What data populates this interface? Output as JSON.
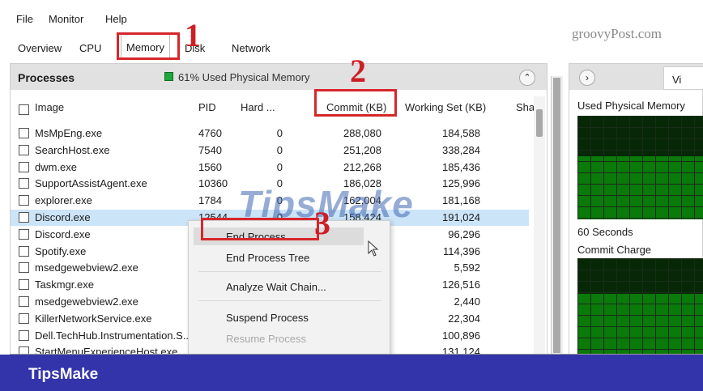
{
  "menu": {
    "file": "File",
    "monitor": "Monitor",
    "help": "Help"
  },
  "tabs": {
    "overview": "Overview",
    "cpu": "CPU",
    "memory": "Memory",
    "disk": "Disk",
    "network": "Network"
  },
  "watermark_top": "groovyPost.com",
  "watermark_mid": "TipsMake",
  "annotations": {
    "n1": "1",
    "n2": "2",
    "n3": "3"
  },
  "processes": {
    "title": "Processes",
    "memory_status": "61% Used Physical Memory",
    "columns": {
      "image": "Image",
      "pid": "PID",
      "hard": "Hard ...",
      "commit": "Commit (KB)",
      "working_set": "Working Set (KB)",
      "shareable": "Sha"
    },
    "rows": [
      {
        "image": "MsMpEng.exe",
        "pid": "4760",
        "hard": "0",
        "commit": "288,080",
        "ws": "184,588"
      },
      {
        "image": "SearchHost.exe",
        "pid": "7540",
        "hard": "0",
        "commit": "251,208",
        "ws": "338,284"
      },
      {
        "image": "dwm.exe",
        "pid": "1560",
        "hard": "0",
        "commit": "212,268",
        "ws": "185,436"
      },
      {
        "image": "SupportAssistAgent.exe",
        "pid": "10360",
        "hard": "0",
        "commit": "186,028",
        "ws": "125,996"
      },
      {
        "image": "explorer.exe",
        "pid": "1784",
        "hard": "0",
        "commit": "162,004",
        "ws": "181,168"
      },
      {
        "image": "Discord.exe",
        "pid": "12544",
        "hard": "0",
        "commit": "158,424",
        "ws": "191,024"
      },
      {
        "image": "Discord.exe",
        "pid": "",
        "hard": "",
        "commit": "",
        "ws": "96,296"
      },
      {
        "image": "Spotify.exe",
        "pid": "",
        "hard": "",
        "commit": "",
        "ws": "114,396"
      },
      {
        "image": "msedgewebview2.exe",
        "pid": "",
        "hard": "",
        "commit": "",
        "ws": "5,592"
      },
      {
        "image": "Taskmgr.exe",
        "pid": "",
        "hard": "",
        "commit": "",
        "ws": "126,516"
      },
      {
        "image": "msedgewebview2.exe",
        "pid": "",
        "hard": "",
        "commit": "",
        "ws": "2,440"
      },
      {
        "image": "KillerNetworkService.exe",
        "pid": "",
        "hard": "",
        "commit": "",
        "ws": "22,304"
      },
      {
        "image": "Dell.TechHub.Instrumentation.S...",
        "pid": "",
        "hard": "",
        "commit": "",
        "ws": "100,896"
      },
      {
        "image": "StartMenuExperienceHost.exe",
        "pid": "",
        "hard": "",
        "commit": "",
        "ws": "131,124"
      }
    ]
  },
  "context_menu": {
    "end_process": "End Process",
    "end_process_tree": "End Process Tree",
    "analyze": "Analyze Wait Chain...",
    "suspend": "Suspend Process",
    "resume": "Resume Process"
  },
  "right_panel": {
    "tab": "Vi",
    "used_physical_memory": "Used Physical Memory",
    "sixty_seconds": "60 Seconds",
    "commit_charge": "Commit Charge"
  },
  "banner": "TipsMake",
  "colors": {
    "annotation_red": "#d6262b",
    "banner": "#3333aa",
    "graph_green": "#0a7a0a",
    "selection": "#cce4f7"
  }
}
